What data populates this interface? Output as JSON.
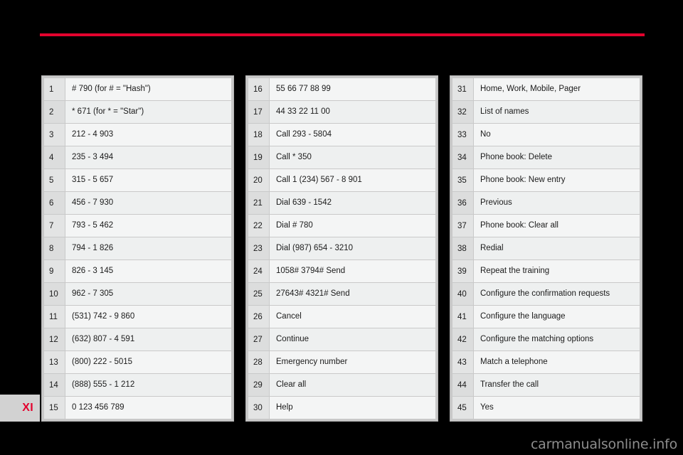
{
  "page": {
    "marker": "XI",
    "marker_color": "#e3032e",
    "rule_color": "#e3032e",
    "background_color": "#000000"
  },
  "watermark": {
    "text": "carmanualsonline.info",
    "color": "#8d8d8d"
  },
  "tables": [
    {
      "name": "commands-table-1",
      "rows": [
        {
          "index": "1",
          "text": "# 790 (for # = \"Hash\")"
        },
        {
          "index": "2",
          "text": "* 671 (for * = \"Star\")"
        },
        {
          "index": "3",
          "text": "212 - 4 903"
        },
        {
          "index": "4",
          "text": "235 - 3 494"
        },
        {
          "index": "5",
          "text": "315 - 5 657"
        },
        {
          "index": "6",
          "text": "456 - 7 930"
        },
        {
          "index": "7",
          "text": "793 - 5 462"
        },
        {
          "index": "8",
          "text": "794 - 1 826"
        },
        {
          "index": "9",
          "text": "826 - 3 145"
        },
        {
          "index": "10",
          "text": "962 - 7 305"
        },
        {
          "index": "11",
          "text": "(531) 742 - 9 860"
        },
        {
          "index": "12",
          "text": "(632) 807 - 4 591"
        },
        {
          "index": "13",
          "text": "(800) 222 - 5015"
        },
        {
          "index": "14",
          "text": "(888) 555 - 1 212"
        },
        {
          "index": "15",
          "text": "0 123 456 789"
        }
      ]
    },
    {
      "name": "commands-table-2",
      "rows": [
        {
          "index": "16",
          "text": "55 66 77 88 99"
        },
        {
          "index": "17",
          "text": "44 33 22 11 00"
        },
        {
          "index": "18",
          "text": "Call 293 - 5804"
        },
        {
          "index": "19",
          "text": "Call * 350"
        },
        {
          "index": "20",
          "text": "Call 1 (234) 567 - 8 901"
        },
        {
          "index": "21",
          "text": "Dial 639 - 1542"
        },
        {
          "index": "22",
          "text": "Dial # 780"
        },
        {
          "index": "23",
          "text": "Dial (987) 654 - 3210"
        },
        {
          "index": "24",
          "text": "1058# 3794# Send"
        },
        {
          "index": "25",
          "text": "27643# 4321# Send"
        },
        {
          "index": "26",
          "text": "Cancel"
        },
        {
          "index": "27",
          "text": "Continue"
        },
        {
          "index": "28",
          "text": "Emergency number"
        },
        {
          "index": "29",
          "text": "Clear all"
        },
        {
          "index": "30",
          "text": "Help"
        }
      ]
    },
    {
      "name": "commands-table-3",
      "rows": [
        {
          "index": "31",
          "text": "Home, Work, Mobile, Pager"
        },
        {
          "index": "32",
          "text": "List of names"
        },
        {
          "index": "33",
          "text": "No"
        },
        {
          "index": "34",
          "text": "Phone book: Delete"
        },
        {
          "index": "35",
          "text": "Phone book: New entry"
        },
        {
          "index": "36",
          "text": "Previous"
        },
        {
          "index": "37",
          "text": "Phone book: Clear all"
        },
        {
          "index": "38",
          "text": "Redial"
        },
        {
          "index": "39",
          "text": "Repeat the training"
        },
        {
          "index": "40",
          "text": "Configure the confirmation requests"
        },
        {
          "index": "41",
          "text": "Configure the language"
        },
        {
          "index": "42",
          "text": "Configure the matching options"
        },
        {
          "index": "43",
          "text": "Match a telephone"
        },
        {
          "index": "44",
          "text": "Transfer the call"
        },
        {
          "index": "45",
          "text": "Yes"
        }
      ]
    }
  ]
}
